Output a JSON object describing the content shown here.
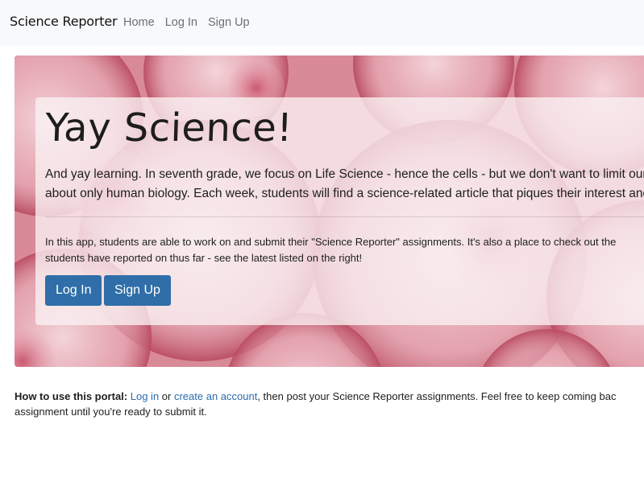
{
  "navbar": {
    "brand": "Science Reporter",
    "links": [
      "Home",
      "Log In",
      "Sign Up"
    ]
  },
  "hero": {
    "title": "Yay Science!",
    "lead_line1": "And yay learning. In seventh grade, we focus on Life Science - hence the cells - but we don't want to limit ourse",
    "lead_line2": "about only human biology. Each week, students will find a science-related article that piques their interest and s",
    "body_line1": "In this app, students are able to work on and submit their \"Science Reporter\" assignments. It's also a place to check out the",
    "body_line2": "students have reported on thus far - see the latest listed on the right!",
    "login_button": "Log In",
    "signup_button": "Sign Up"
  },
  "howto": {
    "heading": "How to use this portal:",
    "login_link": "Log in",
    "or_text": " or ",
    "create_link": "create an account",
    "rest_line1": ", then post your Science Reporter assignments. Feel free to keep coming bac",
    "line2": "assignment until you're ready to submit it."
  },
  "colors": {
    "navbar_bg": "#f8f9fa",
    "button_bg": "#2f6ea8",
    "link": "#2a6bb0",
    "hero_tint": "#cf6b7d"
  }
}
